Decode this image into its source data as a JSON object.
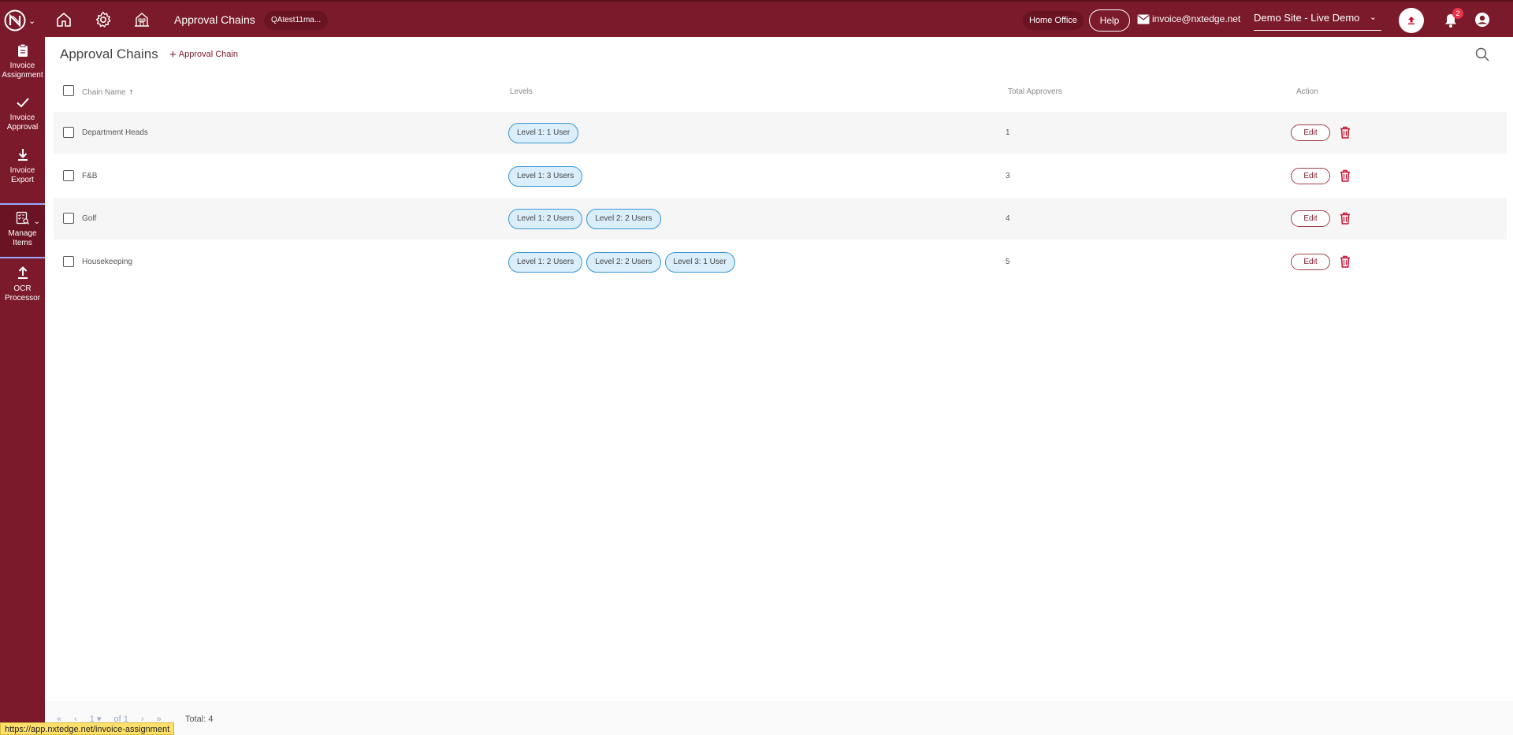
{
  "topbar": {
    "title": "Approval Chains",
    "user": "QAtest11ma...",
    "home_office": "Home Office",
    "help": "Help",
    "email": "invoice@nxtedge.net",
    "site": "Demo Site - Live Demo",
    "notification_count": "2",
    "icons": [
      "home-icon",
      "gear-icon",
      "property-icon",
      "upload-icon",
      "bell-icon",
      "account-icon"
    ]
  },
  "sidebar": {
    "items": [
      {
        "line1": "Invoice",
        "line2": "Assignment",
        "icon": "clipboard-icon"
      },
      {
        "line1": "Invoice",
        "line2": "Approval",
        "icon": "check-icon"
      },
      {
        "line1": "Invoice",
        "line2": "Export",
        "icon": "download-icon"
      },
      {
        "line1": "Manage",
        "line2": "Items",
        "icon": "manage-items-icon"
      },
      {
        "line1": "OCR",
        "line2": "Processor",
        "icon": "upload-icon"
      }
    ]
  },
  "main": {
    "title": "Approval Chains",
    "add_label": "Approval Chain",
    "columns": {
      "name": "Chain Name",
      "levels": "Levels",
      "total": "Total Approvers",
      "action": "Action"
    },
    "rows": [
      {
        "name": "Department Heads",
        "levels": [
          "Level 1: 1 User"
        ],
        "total": "1",
        "edit": "Edit"
      },
      {
        "name": "F&B",
        "levels": [
          "Level 1: 3 Users"
        ],
        "total": "3",
        "edit": "Edit"
      },
      {
        "name": "Golf",
        "levels": [
          "Level 1: 2 Users",
          "Level 2: 2 Users"
        ],
        "total": "4",
        "edit": "Edit"
      },
      {
        "name": "Housekeeping",
        "levels": [
          "Level 1: 2 Users",
          "Level 2: 2 Users",
          "Level 3: 1 User"
        ],
        "total": "5",
        "edit": "Edit"
      }
    ]
  },
  "pager": {
    "first": "«",
    "prev": "‹",
    "page": "1",
    "of": "of 1",
    "next": "›",
    "last": "»",
    "total": "Total: 4"
  },
  "status_url": "https://app.nxtedge.net/invoice-assignment",
  "colors": {
    "brand": "#7a1a2a",
    "pill_border": "#3a95d4",
    "pill_bg": "#dbeefb",
    "delete": "#c8102e"
  }
}
